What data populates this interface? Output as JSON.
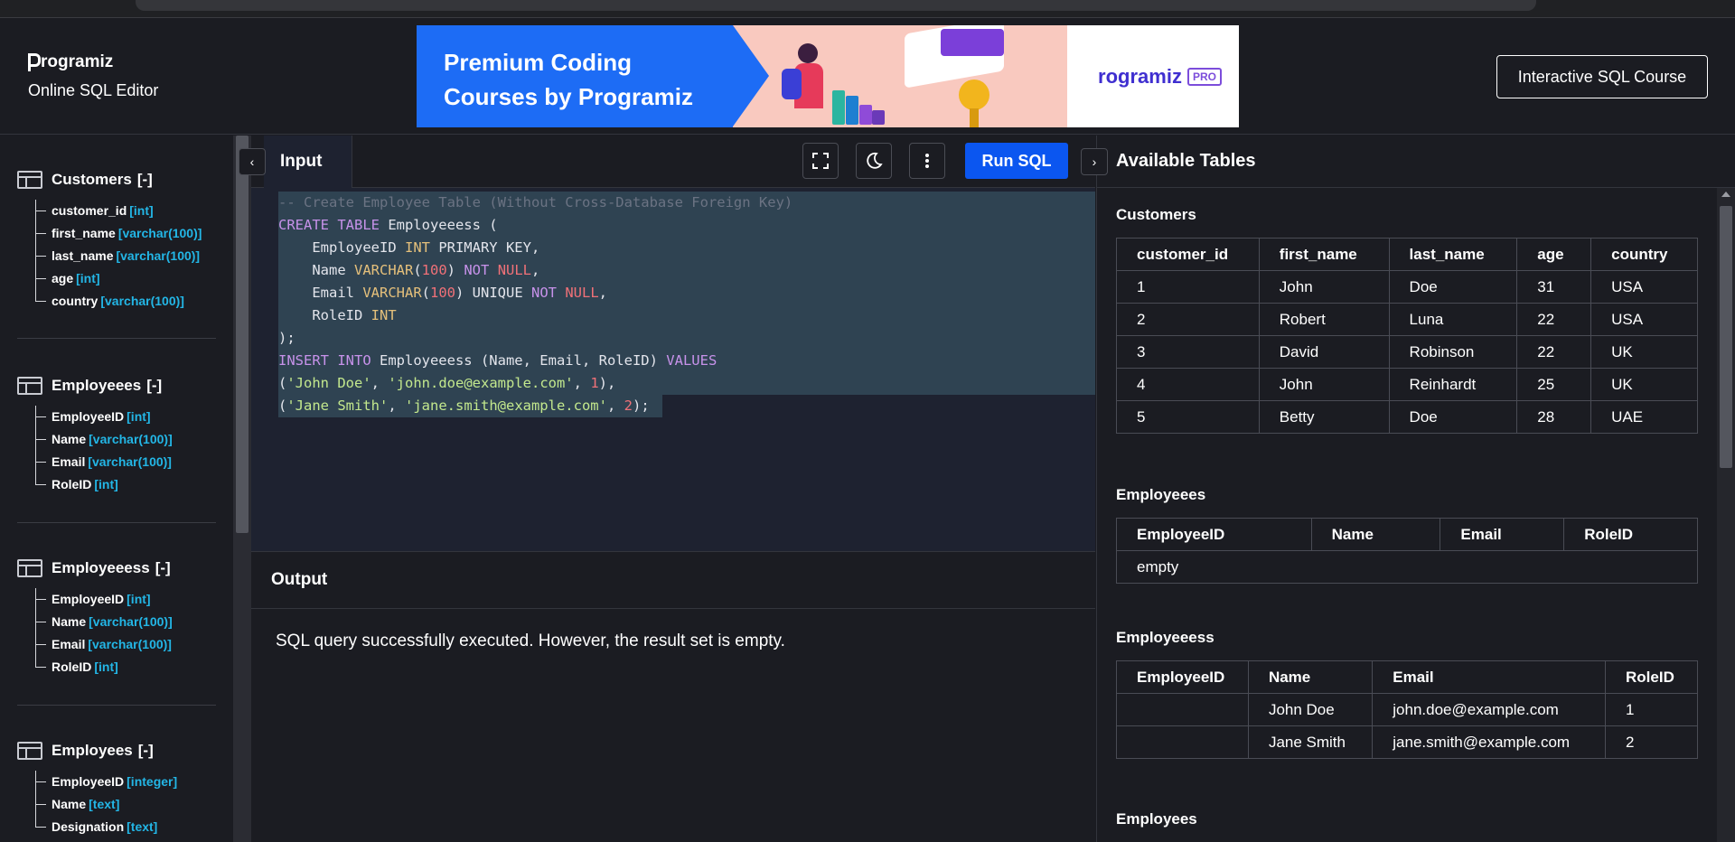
{
  "header": {
    "brand": "rogramiz",
    "subtitle": "Online SQL Editor",
    "banner_line1": "Premium Coding",
    "banner_line2": "Courses by Programiz",
    "banner_brand": "rogramiz",
    "banner_badge": "PRO",
    "course_button": "Interactive SQL Course"
  },
  "sidebar": {
    "tables": [
      {
        "name": "Customers",
        "toggle": "[-]",
        "columns": [
          {
            "name": "customer_id",
            "type": "[int]"
          },
          {
            "name": "first_name",
            "type": "[varchar(100)]"
          },
          {
            "name": "last_name",
            "type": "[varchar(100)]"
          },
          {
            "name": "age",
            "type": "[int]"
          },
          {
            "name": "country",
            "type": "[varchar(100)]"
          }
        ]
      },
      {
        "name": "Employeees",
        "toggle": "[-]",
        "columns": [
          {
            "name": "EmployeeID",
            "type": "[int]"
          },
          {
            "name": "Name",
            "type": "[varchar(100)]"
          },
          {
            "name": "Email",
            "type": "[varchar(100)]"
          },
          {
            "name": "RoleID",
            "type": "[int]"
          }
        ]
      },
      {
        "name": "Employeeess",
        "toggle": "[-]",
        "columns": [
          {
            "name": "EmployeeID",
            "type": "[int]"
          },
          {
            "name": "Name",
            "type": "[varchar(100)]"
          },
          {
            "name": "Email",
            "type": "[varchar(100)]"
          },
          {
            "name": "RoleID",
            "type": "[int]"
          }
        ]
      },
      {
        "name": "Employees",
        "toggle": "[-]",
        "columns": [
          {
            "name": "EmployeeID",
            "type": "[integer]"
          },
          {
            "name": "Name",
            "type": "[text]"
          },
          {
            "name": "Designation",
            "type": "[text]"
          }
        ]
      }
    ]
  },
  "editor": {
    "tab_label": "Input",
    "run_label": "Run SQL",
    "code": {
      "l1": "-- Create Employee Table (Without Cross-Database Foreign Key)",
      "l2_kw": "CREATE TABLE",
      "l2_rest": " Employeeess (",
      "l3_a": "    EmployeeID ",
      "l3_ty": "INT",
      "l3_b": " PRIMARY KEY,",
      "l4_a": "    Name ",
      "l4_ty": "VARCHAR",
      "l4_p1": "(",
      "l4_n": "100",
      "l4_p2": ") ",
      "l4_kw": "NOT",
      "l4_sp": " ",
      "l4_null": "NULL",
      "l4_c": ",",
      "l5_a": "    Email ",
      "l5_ty": "VARCHAR",
      "l5_p1": "(",
      "l5_n": "100",
      "l5_p2": ") UNIQUE ",
      "l5_kw": "NOT",
      "l5_sp": " ",
      "l5_null": "NULL",
      "l5_c": ",",
      "l6_a": "    RoleID ",
      "l6_ty": "INT",
      "l7": ");",
      "l8_kw": "INSERT INTO",
      "l8_mid": " Employeeess (Name, Email, RoleID) ",
      "l8_kw2": "VALUES",
      "l9_a": "(",
      "l9_s1": "'John Doe'",
      "l9_b": ", ",
      "l9_s2": "'john.doe@example.com'",
      "l9_c": ", ",
      "l9_n": "1",
      "l9_d": "),",
      "l10_a": "(",
      "l10_s1": "'Jane Smith'",
      "l10_b": ", ",
      "l10_s2": "'jane.smith@example.com'",
      "l10_c": ", ",
      "l10_n": "2",
      "l10_d": ");"
    }
  },
  "output": {
    "title": "Output",
    "message": "SQL query successfully executed. However, the result set is empty."
  },
  "available": {
    "title": "Available Tables",
    "customers": {
      "name": "Customers",
      "headers": [
        "customer_id",
        "first_name",
        "last_name",
        "age",
        "country"
      ],
      "rows": [
        [
          "1",
          "John",
          "Doe",
          "31",
          "USA"
        ],
        [
          "2",
          "Robert",
          "Luna",
          "22",
          "USA"
        ],
        [
          "3",
          "David",
          "Robinson",
          "22",
          "UK"
        ],
        [
          "4",
          "John",
          "Reinhardt",
          "25",
          "UK"
        ],
        [
          "5",
          "Betty",
          "Doe",
          "28",
          "UAE"
        ]
      ]
    },
    "employeees": {
      "name": "Employeees",
      "headers": [
        "EmployeeID",
        "Name",
        "Email",
        "RoleID"
      ],
      "empty": "empty"
    },
    "employeeess": {
      "name": "Employeeess",
      "headers": [
        "EmployeeID",
        "Name",
        "Email",
        "RoleID"
      ],
      "rows": [
        [
          "",
          "John Doe",
          "john.doe@example.com",
          "1"
        ],
        [
          "",
          "Jane Smith",
          "jane.smith@example.com",
          "2"
        ]
      ]
    },
    "employees": {
      "name": "Employees"
    }
  },
  "colors": {
    "accent": "#0b56f0",
    "type_color": "#23b6e6",
    "selection": "#2f4352"
  }
}
